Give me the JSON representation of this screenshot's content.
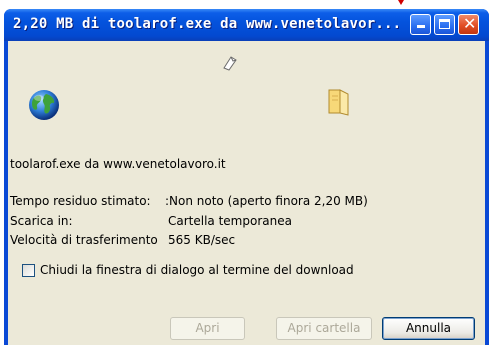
{
  "window": {
    "title": "2,20 MB di toolarof.exe da www.venetolavor...",
    "controls": {
      "minimize_icon": "minimize-icon",
      "maximize_icon": "maximize-icon",
      "close_icon": "close-icon"
    }
  },
  "dialog": {
    "source_text": "toolarof.exe da www.venetolavoro.it",
    "fields": [
      {
        "label": "Tempo residuo stimato:",
        "value": ":Non noto (aperto finora 2,20 MB)"
      },
      {
        "label": "Scarica in:",
        "value": "Cartella temporanea"
      },
      {
        "label": "Velocità di trasferimento",
        "value": "565 KB/sec"
      }
    ],
    "checkbox_label": "Chiudi la finestra di dialogo al termine del download",
    "checkbox_checked": false
  },
  "buttons": {
    "open": "Apri",
    "open_folder": "Apri cartella",
    "cancel": "Annulla"
  },
  "icons": {
    "globe": "globe-icon",
    "folder": "folder-icon",
    "document": "flying-document-icon"
  },
  "colors": {
    "titlebar": "#0453dd",
    "client": "#ece9d8",
    "close_button": "#e24e26"
  }
}
